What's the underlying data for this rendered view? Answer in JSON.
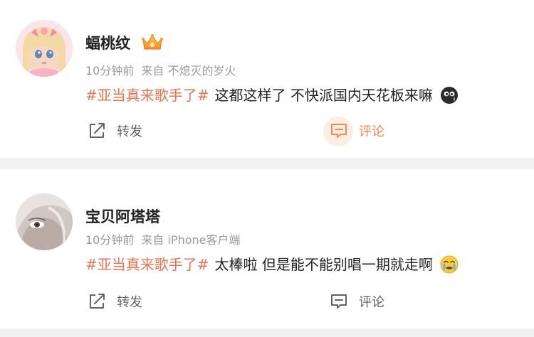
{
  "posts": [
    {
      "username": "蝠桃纹",
      "time": "10分钟前",
      "source_prefix": "来自",
      "source": "不熄灭的岁火",
      "hashtag": "#亚当真来歌手了#",
      "text": "这都这样了 不快派国内天花板来嘛",
      "emoji": "sweat-drop-face-icon",
      "forward_label": "转发",
      "comment_label": "评论",
      "comment_active_color": "#f5884e"
    },
    {
      "username": "宝贝阿塔塔",
      "time": "10分钟前",
      "source_prefix": "来自",
      "source": "iPhone客户端",
      "hashtag": "#亚当真来歌手了#",
      "text": "太棒啦 但是能不能别唱一期就走啊",
      "emoji": "crying-face-icon",
      "forward_label": "转发",
      "comment_label": "评论"
    }
  ],
  "colors": {
    "hashtag": "#eb7350",
    "meta": "#9a9a9a",
    "separator": "#f1f1f1"
  }
}
